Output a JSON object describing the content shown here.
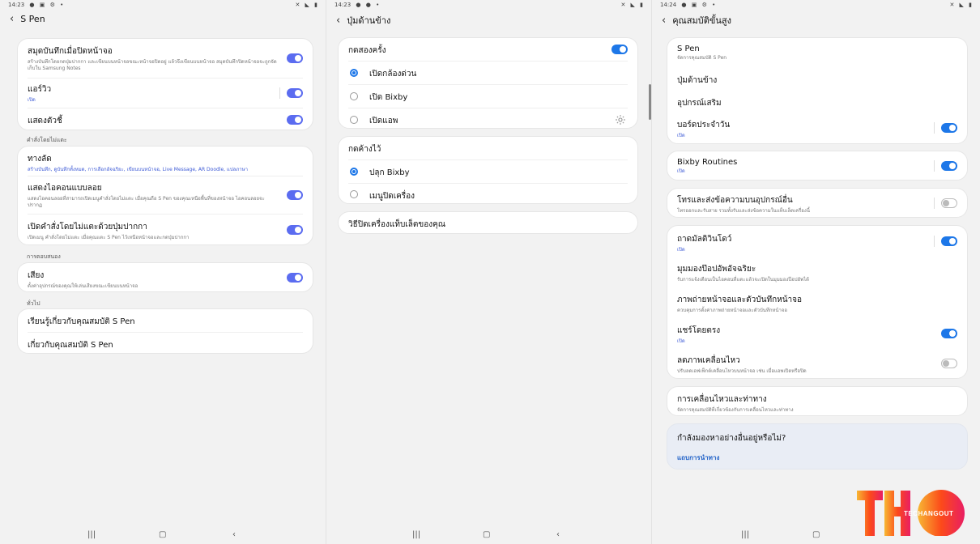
{
  "panel1": {
    "status": {
      "time": "14:23"
    },
    "title": "S Pen",
    "card1": [
      {
        "title": "สมุดบันทึกเมื่อปิดหน้าจอ",
        "sub": "สร้างบันทึกโดยกดปุ่มปากกา และเขียนบนหน้าจอขณะหน้าจอปิดอยู่ แล้วจึงเขียนบนหน้าจอ สมุดบันทึกปิดหน้าจอจะถูกจัดเก็บใน Samsung Notes",
        "on": true
      },
      {
        "title": "แอร์วิว",
        "sub": "เปิด",
        "on": true
      },
      {
        "title": "แสดงตัวชี้",
        "sub": "",
        "on": true
      }
    ],
    "section1": "คำสั่งโดยไม่แตะ",
    "card2": [
      {
        "title": "ทางลัด",
        "sub": "สร้างบันทึก, ดูบันทึกทั้งหมด, การเลือกอัจฉริยะ, เขียนบนหน้าจอ, Live Message, AR Doodle, แปลภาษา"
      },
      {
        "title": "แสดงไอคอนแบบลอย",
        "sub": "แสดงไอคอนลอยที่สามารถเปิดเมนูคำสั่งโดยไม่แตะ เมื่อคุณถือ S Pen ของคุณเหนือพื้นที่ของหน้าจอ ไอคอนลอยจะปรากฏ",
        "on": true
      },
      {
        "title": "เปิดคำสั่งโดยไม่แตะด้วยปุ่มปากกา",
        "sub": "เปิดเมนู คำสั่งโดยไม่แตะ เมื่อคุณแตะ S Pen ไว้เหนือหน้าจอและกดปุ่มปากกา",
        "on": true
      }
    ],
    "section2": "การตอบสนอง",
    "card3": [
      {
        "title": "เสียง",
        "sub": "ตั้งค่าอุปกรณ์ของคุณให้เล่นเสียงขณะเขียนบนหน้าจอ",
        "on": true
      }
    ],
    "section3": "ทั่วไป",
    "card4": [
      {
        "title": "เรียนรู้เกี่ยวกับคุณสมบัติ S Pen"
      },
      {
        "title": "เกี่ยวกับคุณสมบัติ S Pen"
      }
    ]
  },
  "panel2": {
    "status": {
      "time": "14:23"
    },
    "title": "ปุ่มด้านข้าง",
    "double_press": {
      "title": "กดสองครั้ง",
      "on": true,
      "options": [
        "เปิดกล้องด่วน",
        "เปิด Bixby",
        "เปิดแอพ"
      ],
      "selected": 0
    },
    "long_press": {
      "title": "กดค้างไว้",
      "options": [
        "ปลุก Bixby",
        "เมนูปิดเครื่อง"
      ],
      "selected": 0
    },
    "shutdown_link": "วิธีปิดเครื่องแท็บเล็ตของคุณ"
  },
  "panel3": {
    "status": {
      "time": "14:24"
    },
    "title": "คุณสมบัติขั้นสูง",
    "card1": [
      {
        "title": "S Pen",
        "sub": "จัดการคุณสมบัติ S Pen"
      },
      {
        "title": "ปุ่มด้านข้าง",
        "sub": ""
      },
      {
        "title": "อุปกรณ์เสริม",
        "sub": ""
      },
      {
        "title": "บอร์ดประจำวัน",
        "sub": "เปิด",
        "on": true
      }
    ],
    "card2": [
      {
        "title": "Bixby Routines",
        "sub": "เปิด",
        "on": true
      }
    ],
    "card3": [
      {
        "title": "โทรและส่งข้อความบนอุปกรณ์อื่น",
        "sub": "โทรออกและรับสาย รวมทั้งรับและส่งข้อความในแท็บเล็ตเครื่องนี้",
        "on": false
      }
    ],
    "card4": [
      {
        "title": "ถาดมัลติวินโดว์",
        "sub": "เปิด",
        "on": true
      },
      {
        "title": "มุมมองป๊อปอัพอัจฉริยะ",
        "sub": "รับการแจ้งเตือนเป็นไอคอนที่แตะแล้วจะเปิดในมุมมองป๊อปอัพได้"
      },
      {
        "title": "ภาพถ่ายหน้าจอและตัวบันทึกหน้าจอ",
        "sub": "ควบคุมการตั้งค่าภาพถ่ายหน้าจอและตัวบันทึกหน้าจอ"
      },
      {
        "title": "แชร์โดยตรง",
        "sub": "เปิด",
        "on": true
      },
      {
        "title": "ลดภาพเคลื่อนไหว",
        "sub": "ปรับลดเอฟเฟ็กต์เคลื่อนไหวบนหน้าจอ เช่น เมื่อแอพเปิดหรือปิด",
        "on": false
      }
    ],
    "card5": [
      {
        "title": "การเคลื่อนไหวและท่าทาง",
        "sub": "จัดการคุณสมบัติที่เกี่ยวข้องกับการเคลื่อนไหวและท่าทาง"
      }
    ],
    "suggest": {
      "title": "กำลังมองหาอย่างอื่นอยู่หรือไม่?",
      "link": "แถบการนำทาง"
    }
  },
  "logo": {
    "text": "TECHANGOUT",
    "colors": [
      "#f7b733",
      "#fc4a1a",
      "#e91e63"
    ]
  }
}
